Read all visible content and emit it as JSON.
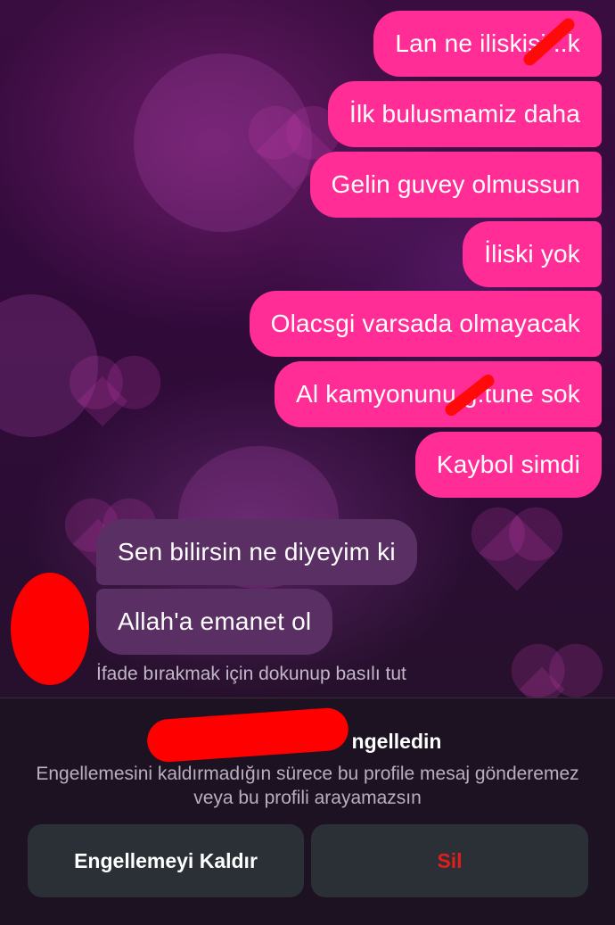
{
  "messages": [
    {
      "direction": "outgoing",
      "text": "Lan ne iliskisi ..k"
    },
    {
      "direction": "outgoing",
      "text": "İlk bulusmamiz daha"
    },
    {
      "direction": "outgoing",
      "text": "Gelin guvey olmussun"
    },
    {
      "direction": "outgoing",
      "text": "İliski yok"
    },
    {
      "direction": "outgoing",
      "text": "Olacsgi varsada olmayacak"
    },
    {
      "direction": "outgoing",
      "text": "Al kamyonunu g.tune sok"
    },
    {
      "direction": "outgoing",
      "text": "Kaybol simdi"
    },
    {
      "direction": "incoming",
      "text": "Sen bilirsin ne diyeyim ki"
    },
    {
      "direction": "incoming",
      "text": "Allah'a emanet ol"
    }
  ],
  "reaction_hint": "İfade bırakmak için dokunup basılı tut",
  "blocked": {
    "title_suffix": "ngelledin",
    "description": "Engellemesini kaldırmadığın sürece bu profile mesaj gönderemez veya bu profili arayamazsın",
    "unblock_label": "Engellemeyi Kaldır",
    "delete_label": "Sil"
  },
  "colors": {
    "outgoing_bubble": "#ff2d95",
    "incoming_bubble": "#5a2f63",
    "delete_text": "#e01e1e",
    "redaction": "#ff0000"
  }
}
